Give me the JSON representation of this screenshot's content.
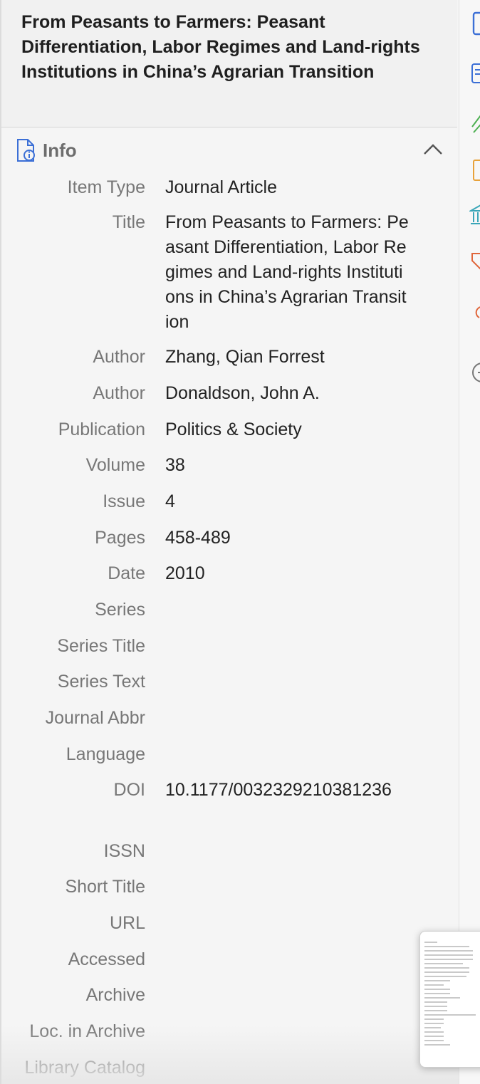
{
  "header": {
    "title": "From Peasants to Farmers: Peasant Differentiation, Labor Regimes and Land-rights Institutions in China’s Agrarian Transition"
  },
  "section": {
    "label": "Info",
    "icon": "document-info-icon"
  },
  "fields": [
    {
      "label": "Item Type",
      "value": "Journal Article"
    },
    {
      "label": "Title",
      "value": "From Peasants to Farmers: Peasant Differentiation, Labor Regimes and Land-rights Institutions in China’s Agrarian Transition"
    },
    {
      "label": "Author",
      "value": "Zhang, Qian Forrest"
    },
    {
      "label": "Author",
      "value": "Donaldson, John A."
    },
    {
      "label": "Publication",
      "value": "Politics & Society"
    },
    {
      "label": "Volume",
      "value": "38"
    },
    {
      "label": "Issue",
      "value": "4"
    },
    {
      "label": "Pages",
      "value": "458-489"
    },
    {
      "label": "Date",
      "value": "2010"
    },
    {
      "label": "Series",
      "value": ""
    },
    {
      "label": "Series Title",
      "value": ""
    },
    {
      "label": "Series Text",
      "value": ""
    },
    {
      "label": "Journal Abbr",
      "value": ""
    },
    {
      "label": "Language",
      "value": ""
    },
    {
      "label": "DOI",
      "value": "10.1177/0032329210381236"
    },
    {
      "label": "ISSN",
      "value": ""
    },
    {
      "label": "Short Title",
      "value": ""
    },
    {
      "label": "URL",
      "value": ""
    },
    {
      "label": "Accessed",
      "value": ""
    },
    {
      "label": "Archive",
      "value": ""
    },
    {
      "label": "Loc. in Archive",
      "value": ""
    },
    {
      "label": "Library Catalog",
      "value": ""
    }
  ],
  "sidebar_icons": [
    "info-icon",
    "abstract-icon",
    "attachments-icon",
    "notes-icon",
    "libraries-icon",
    "tags-icon",
    "related-icon",
    "locate-icon"
  ],
  "colors": {
    "accent": "#3b6fd6",
    "tags": "#e0663b",
    "attachments": "#4caf50",
    "notes": "#e8a23a",
    "libraries": "#3aa6b8"
  }
}
